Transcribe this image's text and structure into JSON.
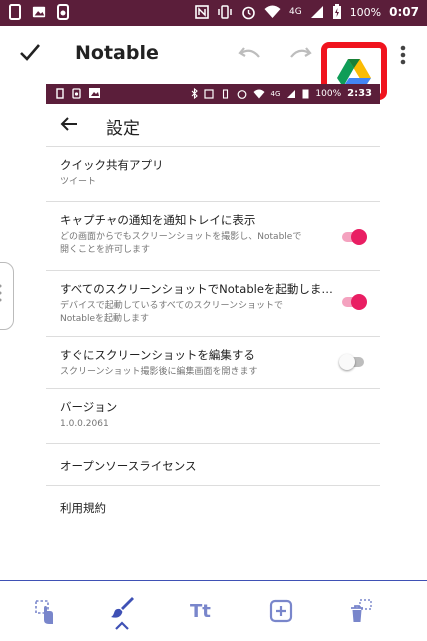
{
  "status_bar": {
    "battery": "100%",
    "network": "4G",
    "time": "0:07"
  },
  "app_bar": {
    "title": "Notable"
  },
  "inner_screen": {
    "status_bar": {
      "battery": "100%",
      "network": "4G",
      "time": "2:33"
    },
    "title": "設定",
    "items": [
      {
        "title": "クイック共有アプリ",
        "subtitle": "ツイート"
      },
      {
        "title": "キャプチャの通知を通知トレイに表示",
        "subtitle_line1": "どの画面からでもスクリーンショットを撮影し、Notableで",
        "subtitle_line2": "開くことを許可します",
        "toggle": "on"
      },
      {
        "title": "すべてのスクリーンショットでNotableを起動しま…",
        "subtitle_line1": "デバイスで起動しているすべてのスクリーンショットで",
        "subtitle_line2": "Notableを起動します",
        "toggle": "on"
      },
      {
        "title": "すぐにスクリーンショットを編集する",
        "subtitle": "スクリーンショット撮影後に編集画面を開きます",
        "toggle": "off"
      },
      {
        "title": "バージョン",
        "subtitle": "1.0.0.2061"
      },
      {
        "title": "オープンソースライセンス"
      },
      {
        "title": "利用規約"
      }
    ]
  },
  "bottom_toolbar": {
    "text_tool_label": "Tt"
  },
  "colors": {
    "status_bar": "#5b1e3a",
    "accent_pink": "#e91e63",
    "toolbar_blue": "#3f51b5",
    "highlight_red": "#f0141e"
  }
}
